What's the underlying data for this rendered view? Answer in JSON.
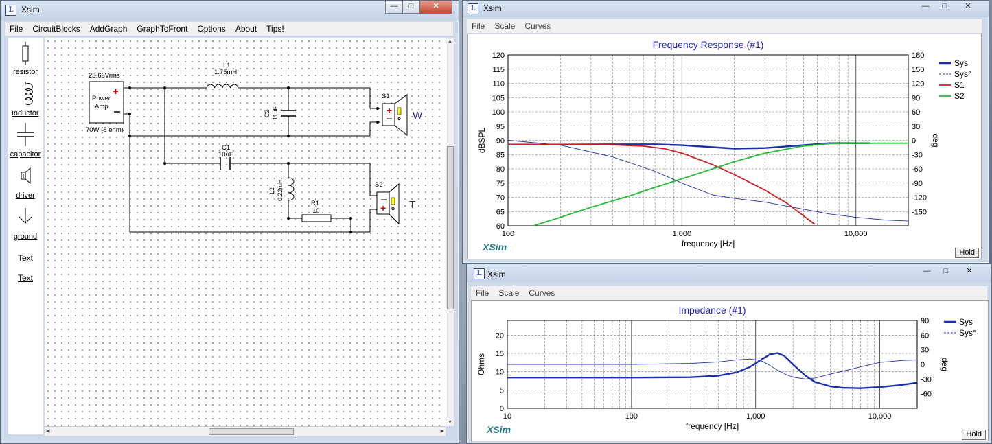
{
  "app_title": "Xsim",
  "main_window": {
    "menu": [
      "File",
      "CircuitBlocks",
      "AddGraph",
      "GraphToFront",
      "Options",
      "About",
      "Tips!"
    ],
    "palette": [
      {
        "name": "resistor",
        "label": "resistor",
        "icon": "resistor-icon"
      },
      {
        "name": "inductor",
        "label": "inductor",
        "icon": "inductor-icon"
      },
      {
        "name": "capacitor",
        "label": "capacitor",
        "icon": "capacitor-icon"
      },
      {
        "name": "driver",
        "label": "driver",
        "icon": "speaker-icon"
      },
      {
        "name": "ground",
        "label": "ground",
        "icon": "ground-icon"
      },
      {
        "name": "text-plain",
        "label": "Text",
        "icon": ""
      },
      {
        "name": "text-underlined",
        "label": "Text",
        "icon": ""
      }
    ],
    "circuit": {
      "amp_voltage": "23.66Vrms",
      "amp_label_line1": "Power",
      "amp_label_line2": "Amp.",
      "amp_power": "70W (8 ohm)",
      "L1_name": "L1",
      "L1_value": "1.75mH",
      "C2_name": "C2",
      "C2_value": "11uF",
      "C1_name": "C1",
      "C1_value": "10uF",
      "L2_name": "L2",
      "L2_value": "0.22mH",
      "R1_name": "R1",
      "R1_value": "10",
      "S1_name": "S1",
      "S1_label": "W",
      "S2_name": "S2",
      "S2_label": "T"
    }
  },
  "freq_window": {
    "menu": [
      "File",
      "Scale",
      "Curves"
    ],
    "hold_label": "Hold",
    "watermark": "XSim"
  },
  "imp_window": {
    "menu": [
      "File",
      "Scale",
      "Curves"
    ],
    "hold_label": "Hold",
    "watermark": "XSim"
  },
  "colors": {
    "sys": "#1a2faa",
    "s1": "#cc2020",
    "s2": "#22bb33",
    "title": "#2222bb"
  },
  "chart_data": [
    {
      "type": "line",
      "title": "Frequency Response (#1)",
      "xlabel": "frequency [Hz]",
      "ylabel": "dBSPL",
      "y2label": "deg",
      "xscale": "log",
      "xlim": [
        100,
        20000
      ],
      "ylim": [
        60,
        120
      ],
      "y2lim": [
        -180,
        180
      ],
      "xticks": [
        "100",
        "1,000",
        "10,000"
      ],
      "yticks": [
        "60",
        "65",
        "70",
        "75",
        "80",
        "85",
        "90",
        "95",
        "100",
        "105",
        "110",
        "115",
        "120"
      ],
      "y2ticks": [
        "-150",
        "-120",
        "-90",
        "-60",
        "-30",
        "0",
        "30",
        "60",
        "90",
        "120",
        "150",
        "180"
      ],
      "grid": true,
      "legend_position": "right",
      "series": [
        {
          "name": "Sys",
          "axis": "left",
          "style": "solid-thick",
          "color": "#1a2faa",
          "x": [
            100,
            200,
            400,
            700,
            1000,
            1500,
            2000,
            3000,
            5000,
            7000,
            10000,
            12000
          ],
          "y": [
            88.5,
            88.5,
            88.6,
            88.6,
            88.3,
            87.6,
            87.1,
            87.3,
            88.3,
            89.0,
            89.0,
            89.0
          ]
        },
        {
          "name": "Sys°",
          "axis": "right",
          "style": "solid-thin",
          "color": "#1a2faa",
          "x": [
            100,
            200,
            400,
            700,
            1000,
            1500,
            2000,
            3000,
            5000,
            7000,
            10000,
            15000,
            20000
          ],
          "y": [
            0,
            -10,
            -35,
            -65,
            -90,
            -115,
            -122,
            -130,
            -145,
            -155,
            -162,
            -168,
            -170
          ]
        },
        {
          "name": "S1",
          "axis": "left",
          "style": "solid",
          "color": "#cc2020",
          "x": [
            100,
            200,
            400,
            600,
            800,
            1000,
            1500,
            2000,
            3000,
            4000,
            5000,
            5800
          ],
          "y": [
            88.5,
            88.5,
            88.4,
            88.0,
            87.0,
            85.5,
            81.5,
            78.0,
            72.5,
            68.0,
            63.5,
            60.5
          ]
        },
        {
          "name": "S2",
          "axis": "left",
          "style": "solid",
          "color": "#22bb33",
          "x": [
            140,
            200,
            300,
            500,
            700,
            1000,
            1500,
            2000,
            3000,
            5000,
            7000,
            10000,
            20000
          ],
          "y": [
            60.0,
            63.0,
            66.5,
            70.5,
            73.5,
            76.5,
            80.0,
            82.5,
            85.5,
            88.0,
            88.8,
            89.0,
            89.0
          ]
        }
      ]
    },
    {
      "type": "line",
      "title": "Impedance (#1)",
      "xlabel": "frequency [Hz]",
      "ylabel": "Ohms",
      "y2label": "deg",
      "xscale": "log",
      "xlim": [
        10,
        20000
      ],
      "ylim": [
        0,
        24
      ],
      "y2lim": [
        -90,
        90
      ],
      "xticks": [
        "10",
        "100",
        "1,000",
        "10,000"
      ],
      "yticks": [
        "0",
        "5",
        "10",
        "15",
        "20"
      ],
      "y2ticks": [
        "-60",
        "-30",
        "0",
        "30",
        "60",
        "90"
      ],
      "grid": true,
      "legend_position": "right",
      "series": [
        {
          "name": "Sys",
          "axis": "left",
          "style": "solid-thick",
          "color": "#1a2faa",
          "x": [
            10,
            100,
            300,
            500,
            700,
            900,
            1100,
            1300,
            1500,
            1700,
            2000,
            2500,
            3000,
            4000,
            5000,
            7000,
            10000,
            15000,
            20000
          ],
          "y": [
            8.4,
            8.4,
            8.5,
            8.9,
            9.8,
            11.3,
            13.2,
            14.7,
            15.1,
            14.3,
            12.0,
            9.0,
            7.2,
            6.0,
            5.6,
            5.5,
            5.8,
            6.4,
            7.0
          ]
        },
        {
          "name": "Sys°",
          "axis": "right",
          "style": "solid-thin",
          "color": "#1a2faa",
          "x": [
            10,
            100,
            300,
            500,
            700,
            900,
            1100,
            1300,
            1500,
            1800,
            2000,
            2500,
            3000,
            4000,
            5000,
            7000,
            10000,
            15000,
            20000
          ],
          "y": [
            0,
            0,
            2,
            5,
            9,
            11,
            8,
            -2,
            -12,
            -22,
            -26,
            -30,
            -28,
            -20,
            -14,
            -5,
            4,
            8,
            9
          ]
        }
      ]
    }
  ]
}
